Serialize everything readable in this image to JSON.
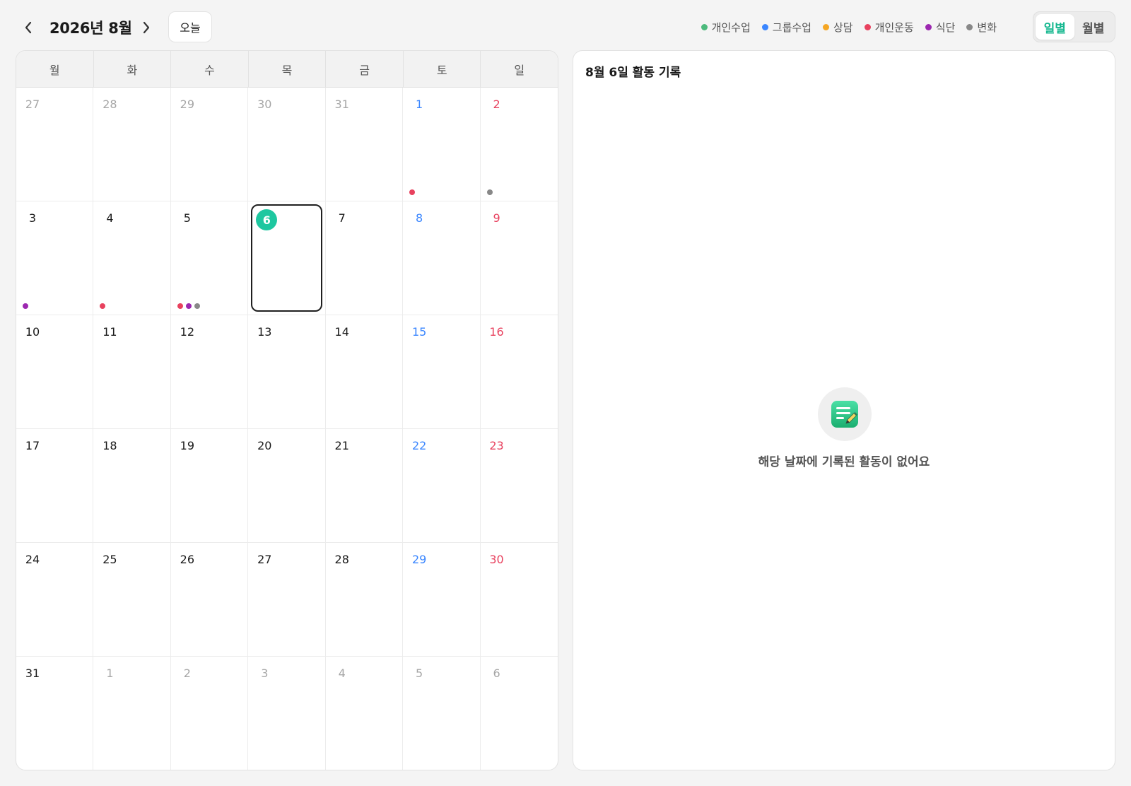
{
  "header": {
    "month_title": "2026년 8월",
    "today_label": "오늘",
    "legend": [
      {
        "label": "개인수업",
        "color": "#4cba7c"
      },
      {
        "label": "그룹수업",
        "color": "#3a86ff"
      },
      {
        "label": "상담",
        "color": "#f5a623"
      },
      {
        "label": "개인운동",
        "color": "#e8415e"
      },
      {
        "label": "식단",
        "color": "#9c27b0"
      },
      {
        "label": "변화",
        "color": "#888888"
      }
    ],
    "view_daily": "일별",
    "view_monthly": "월별"
  },
  "calendar": {
    "weekdays": [
      "월",
      "화",
      "수",
      "목",
      "금",
      "토",
      "일"
    ],
    "cells": [
      {
        "day": "27",
        "other": true
      },
      {
        "day": "28",
        "other": true
      },
      {
        "day": "29",
        "other": true
      },
      {
        "day": "30",
        "other": true
      },
      {
        "day": "31",
        "other": true
      },
      {
        "day": "1",
        "weekend": "sat",
        "dots": [
          "#e8415e"
        ]
      },
      {
        "day": "2",
        "weekend": "sun",
        "dots": [
          "#888888"
        ]
      },
      {
        "day": "3",
        "dots": [
          "#9c27b0"
        ]
      },
      {
        "day": "4",
        "dots": [
          "#e8415e"
        ]
      },
      {
        "day": "5",
        "dots": [
          "#e8415e",
          "#9c27b0",
          "#888888"
        ]
      },
      {
        "day": "6",
        "today": true,
        "selected": true
      },
      {
        "day": "7"
      },
      {
        "day": "8",
        "weekend": "sat"
      },
      {
        "day": "9",
        "weekend": "sun"
      },
      {
        "day": "10"
      },
      {
        "day": "11"
      },
      {
        "day": "12"
      },
      {
        "day": "13"
      },
      {
        "day": "14"
      },
      {
        "day": "15",
        "weekend": "sat"
      },
      {
        "day": "16",
        "weekend": "sun"
      },
      {
        "day": "17"
      },
      {
        "day": "18"
      },
      {
        "day": "19"
      },
      {
        "day": "20"
      },
      {
        "day": "21"
      },
      {
        "day": "22",
        "weekend": "sat"
      },
      {
        "day": "23",
        "weekend": "sun"
      },
      {
        "day": "24"
      },
      {
        "day": "25"
      },
      {
        "day": "26"
      },
      {
        "day": "27"
      },
      {
        "day": "28"
      },
      {
        "day": "29",
        "weekend": "sat"
      },
      {
        "day": "30",
        "weekend": "sun"
      },
      {
        "day": "31"
      },
      {
        "day": "1",
        "other": true
      },
      {
        "day": "2",
        "other": true
      },
      {
        "day": "3",
        "other": true
      },
      {
        "day": "4",
        "other": true
      },
      {
        "day": "5",
        "other": true
      },
      {
        "day": "6",
        "other": true
      }
    ]
  },
  "panel": {
    "title": "8월 6일 활동 기록",
    "empty_message": "해당 날짜에 기록된 활동이 없어요",
    "empty_icon": "note-pencil-icon"
  },
  "colors": {
    "accent": "#1ec7a0",
    "saturday": "#3a86ff",
    "sunday": "#e8415e"
  }
}
